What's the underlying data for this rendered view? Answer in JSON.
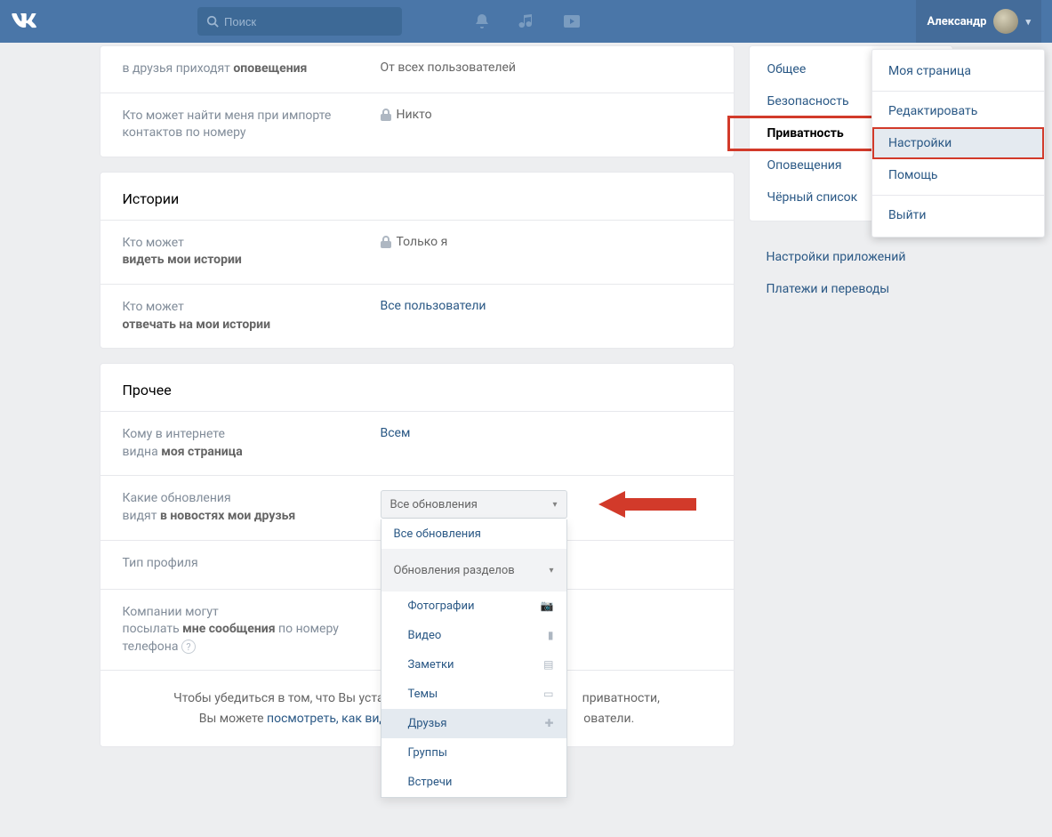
{
  "header": {
    "search_placeholder": "Поиск",
    "user_name": "Александр"
  },
  "dropdown": {
    "items": [
      "Моя страница",
      "Редактировать",
      "Настройки",
      "Помощь",
      "Выйти"
    ]
  },
  "sidebar": {
    "nav": [
      "Общее",
      "Безопасность",
      "Приватность",
      "Оповещения",
      "Чёрный список"
    ],
    "extra": [
      "Настройки приложений",
      "Платежи и переводы"
    ]
  },
  "top_rows": [
    {
      "label_pre": "в друзья приходят ",
      "label_bold": "оповещения",
      "value": "От всех пользователей",
      "locked": false
    },
    {
      "label_pre": "Кто может найти меня при импорте контактов по номеру",
      "label_bold": "",
      "value": "Никто",
      "locked": true
    }
  ],
  "sections": {
    "stories": {
      "title": "Истории",
      "rows": [
        {
          "label_pre": "Кто может",
          "label_bold": "видеть мои истории",
          "value": "Только я",
          "locked": true,
          "blue": false
        },
        {
          "label_pre": "Кто может",
          "label_bold": "отвечать на мои истории",
          "value": "Все пользователи",
          "locked": false,
          "blue": true
        }
      ]
    },
    "other": {
      "title": "Прочее",
      "rows": {
        "r1": {
          "label_pre": "Кому в интернете",
          "label_bold": "видна ",
          "label_bold2": "моя страница",
          "value": "Всем"
        },
        "r2": {
          "label_pre": "Какие обновления",
          "label_bold": "видят ",
          "label_bold2": "в новостях мои друзья",
          "select_value": "Все обновления"
        },
        "r3": {
          "label_pre": "Тип профиля",
          "value": ""
        },
        "r4": {
          "label_pre": "Компании могут",
          "label_bold": "посылать ",
          "label_bold2": "мне сообщения",
          "label_suffix": " по номеру телефона"
        }
      }
    }
  },
  "select_options": {
    "opt1": "Все обновления",
    "header": "Обновления разделов",
    "subs": [
      {
        "label": "Фотографии",
        "icon": "camera"
      },
      {
        "label": "Видео",
        "icon": "film"
      },
      {
        "label": "Заметки",
        "icon": "note"
      },
      {
        "label": "Темы",
        "icon": "chat"
      },
      {
        "label": "Друзья",
        "icon": "plus"
      },
      {
        "label": "Группы",
        "icon": "group"
      },
      {
        "label": "Встречи",
        "icon": "cal"
      }
    ]
  },
  "footer": {
    "line1_a": "Чтобы убедиться в том, что Вы устано",
    "line1_b": "приватности,",
    "line2_a": "Вы можете ",
    "line2_link": "посмотреть, как видят",
    "line2_b": "ователи."
  }
}
